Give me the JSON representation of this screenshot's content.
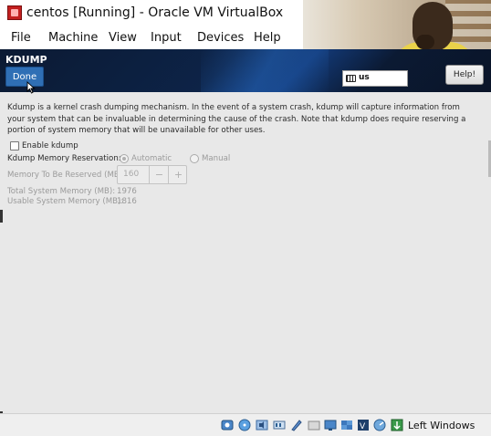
{
  "window": {
    "title": "centos [Running] - Oracle VM VirtualBox"
  },
  "menubar": {
    "items": [
      "File",
      "Machine",
      "View",
      "Input",
      "Devices",
      "Help"
    ]
  },
  "installer": {
    "section_title": "KDUMP",
    "done_label": "Done",
    "keyboard_layout": "us",
    "help_label": "Help!",
    "description": "Kdump is a kernel crash dumping mechanism. In the event of a system crash, kdump will capture information from your system that can be invaluable in determining the cause of the crash. Note that kdump does require reserving a portion of system memory that will be unavailable for other uses.",
    "enable_label": "Enable kdump",
    "enable_checked": false,
    "reservation_label": "Kdump Memory Reservation:",
    "reservation_options": [
      "Automatic",
      "Manual"
    ],
    "reservation_selected": "Automatic",
    "reserve_label": "Memory To Be Reserved (MB):",
    "reserve_value": "160",
    "minus_label": "−",
    "plus_label": "+",
    "total_label": "Total System Memory (MB):",
    "total_value": "1976",
    "usable_label": "Usable System Memory (MB):",
    "usable_value": "1816"
  },
  "statusbar": {
    "host_key": "Left Windows",
    "icons": [
      "hard-disk-icon",
      "optical-disk-icon",
      "audio-icon",
      "network-icon",
      "usb-icon",
      "shared-folders-icon",
      "display-icon",
      "video-capture-icon",
      "capture-icon",
      "cpu-icon",
      "mouse-integration-icon",
      "keyboard-icon"
    ]
  },
  "colors": {
    "header_bg": "#0d2347",
    "done_button": "#2f6fb5",
    "content_bg": "#e8e8e8"
  }
}
